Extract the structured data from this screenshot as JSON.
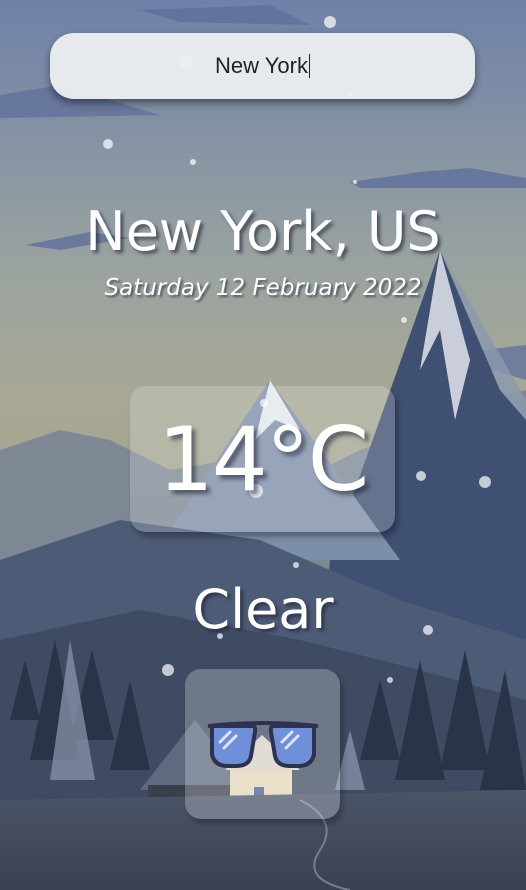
{
  "search": {
    "value": "New York"
  },
  "location": {
    "city": "New York, US",
    "date": "Saturday 12 February 2022"
  },
  "weather": {
    "temperature": "14°C",
    "condition": "Clear",
    "icon": "sunglasses-icon"
  },
  "colors": {
    "sky_top": "#6f81a8",
    "sky_bottom": "#9aa39a",
    "mountain": "#4a5b7c",
    "text": "#ffffff"
  }
}
